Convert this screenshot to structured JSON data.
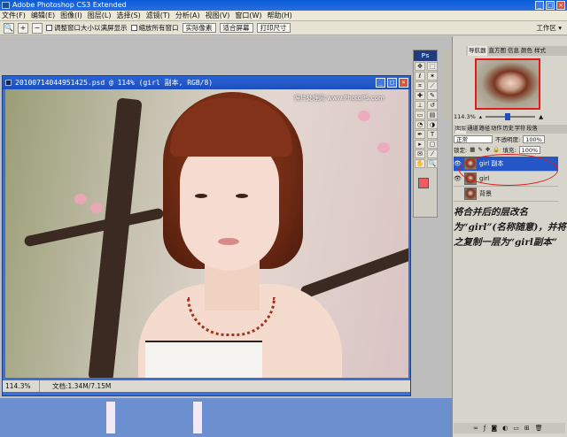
{
  "app": {
    "title": "Adobe Photoshop CS3 Extended",
    "win_min": "_",
    "win_max": "□",
    "win_close": "×"
  },
  "menu": [
    "文件(F)",
    "编辑(E)",
    "图像(I)",
    "图层(L)",
    "选择(S)",
    "滤镜(T)",
    "分析(A)",
    "视图(V)",
    "窗口(W)",
    "帮助(H)"
  ],
  "options": {
    "tool_icon": "zoom-icon",
    "check1": "调整窗口大小以满屏显示",
    "check2": "缩放所有窗口",
    "btn_actual": "实际像素",
    "btn_fit": "适合屏幕",
    "btn_print": "打印尺寸",
    "workspace": "工作区 ▾"
  },
  "document": {
    "title": "20100714044951425.psd @ 114% (girl 副本, RGB/8)",
    "watermark": "照片处理网 www.PhotoPS.com",
    "zoom": "114.3%",
    "file_size": "文档:1.34M/7.15M"
  },
  "navigator": {
    "tabs": [
      "导航器",
      "直方图",
      "信息",
      "颜色",
      "样式"
    ],
    "zoom": "114.3%"
  },
  "layers": {
    "tabs": [
      "图层",
      "通道",
      "路径",
      "动作",
      "历史",
      "字符",
      "段落"
    ],
    "blend_mode": "正常",
    "opacity_label": "不透明度:",
    "opacity": "100%",
    "lock_label": "锁定:",
    "fill_label": "填充:",
    "fill": "100%",
    "items": [
      {
        "name": "girl 副本",
        "selected": true
      },
      {
        "name": "girl",
        "selected": false
      },
      {
        "name": "背景",
        "selected": false
      }
    ]
  },
  "annotation": "将合并后的层改名为“girl”(名称随意)，并将之复制一层为“girl副本”",
  "colors": {
    "foreground": "#f05b5b",
    "background": "#ffffff",
    "selection": "#2457c5",
    "highlight": "#e31919"
  }
}
